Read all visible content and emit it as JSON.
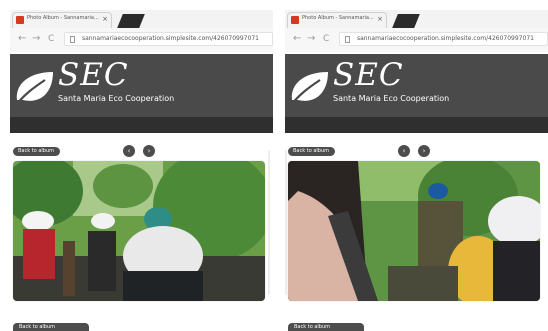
{
  "browser": {
    "tab_title": "Photo Album - Sannamaria...",
    "tab_close": "×",
    "url": "sannamariaecocooperation.simplesite.com/426070997071",
    "back_glyph": "←",
    "forward_glyph": "→",
    "reload_glyph": "C"
  },
  "site": {
    "logo_text": "SEC",
    "tagline": "Santa Maria Eco Cooperation",
    "brand_color": "#4a4a4a"
  },
  "album": {
    "back_label": "Back to album",
    "prev_glyph": "‹",
    "next_glyph": "›",
    "bottom_label": "Back to album"
  },
  "photos": [
    {
      "subject": "group of students in white caps among mangrove trees"
    },
    {
      "subject": "students in mangrove forest, guide in blue cap"
    }
  ],
  "icons": [
    "favicon-icon",
    "close-icon",
    "back-arrow-icon",
    "forward-arrow-icon",
    "reload-icon",
    "page-icon",
    "leaf-logo-icon",
    "prev-icon",
    "next-icon"
  ]
}
